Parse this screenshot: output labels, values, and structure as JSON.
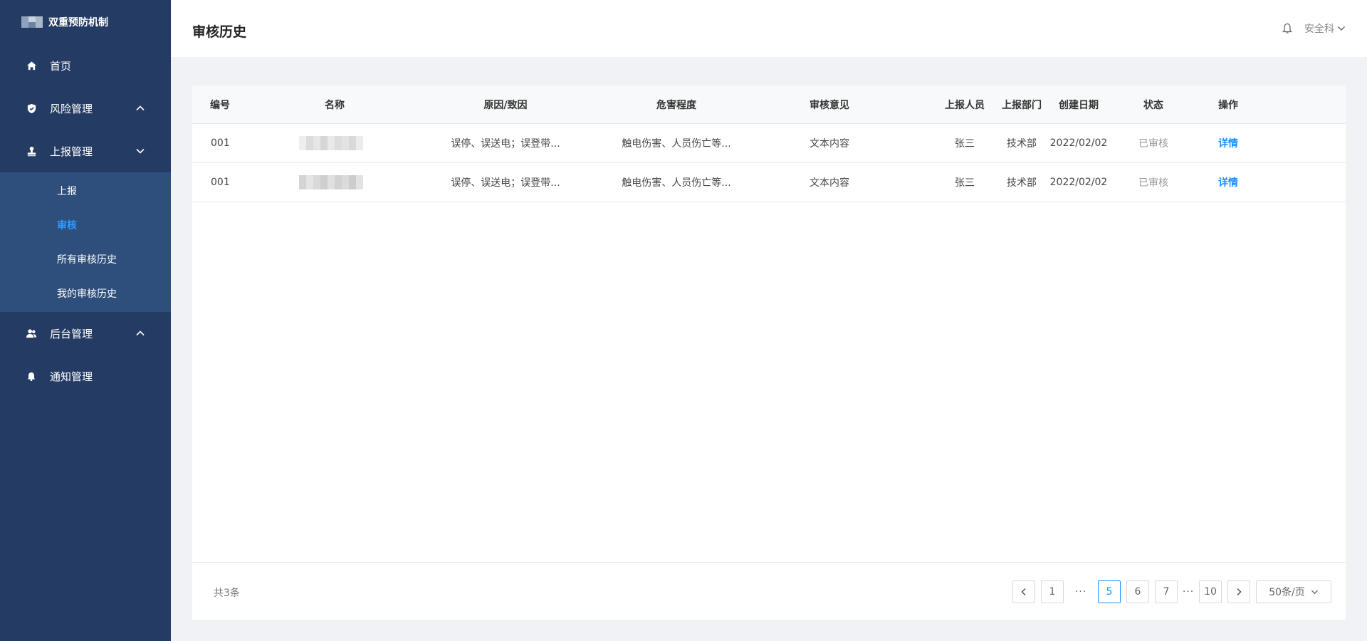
{
  "sidebar": {
    "logo_text": "双重预防机制",
    "menu": [
      {
        "label": "首页",
        "icon": "home-icon"
      },
      {
        "label": "风险管理",
        "icon": "shield-icon",
        "expanded": false
      },
      {
        "label": "上报管理",
        "icon": "stamp-icon",
        "expanded": true
      },
      {
        "label": "后台管理",
        "icon": "users-icon",
        "expanded": false
      },
      {
        "label": "通知管理",
        "icon": "bell-icon"
      }
    ],
    "submenu": [
      {
        "label": "上报",
        "active": false
      },
      {
        "label": "审核",
        "active": true
      },
      {
        "label": "所有审核历史",
        "active": false
      },
      {
        "label": "我的审核历史",
        "active": false
      }
    ]
  },
  "header": {
    "title": "审核历史",
    "user": "安全科"
  },
  "table": {
    "columns": [
      "编号",
      "名称",
      "原因/致因",
      "危害程度",
      "审核意见",
      "上报人员",
      "上报部门",
      "创建日期",
      "状态",
      "操作"
    ],
    "rows": [
      {
        "id": "001",
        "cause": "误停、误送电；误登带...",
        "harm": "触电伤害、人员伤亡等...",
        "opinion": "文本内容",
        "reporter": "张三",
        "dept": "技术部",
        "date": "2022/02/02",
        "status": "已审核",
        "action": "详情"
      },
      {
        "id": "001",
        "cause": "误停、误送电；误登带...",
        "harm": "触电伤害、人员伤亡等...",
        "opinion": "文本内容",
        "reporter": "张三",
        "dept": "技术部",
        "date": "2022/02/02",
        "status": "已审核",
        "action": "详情"
      }
    ]
  },
  "pagination": {
    "total": "共3条",
    "pages": [
      "1",
      "5",
      "6",
      "7",
      "10"
    ],
    "current": "5",
    "ellipsis": "···",
    "page_size": "50条/页"
  },
  "colors": {
    "sidebar_bg": "#243c63",
    "submenu_bg": "#2e4e7c",
    "accent": "#1890ff"
  }
}
